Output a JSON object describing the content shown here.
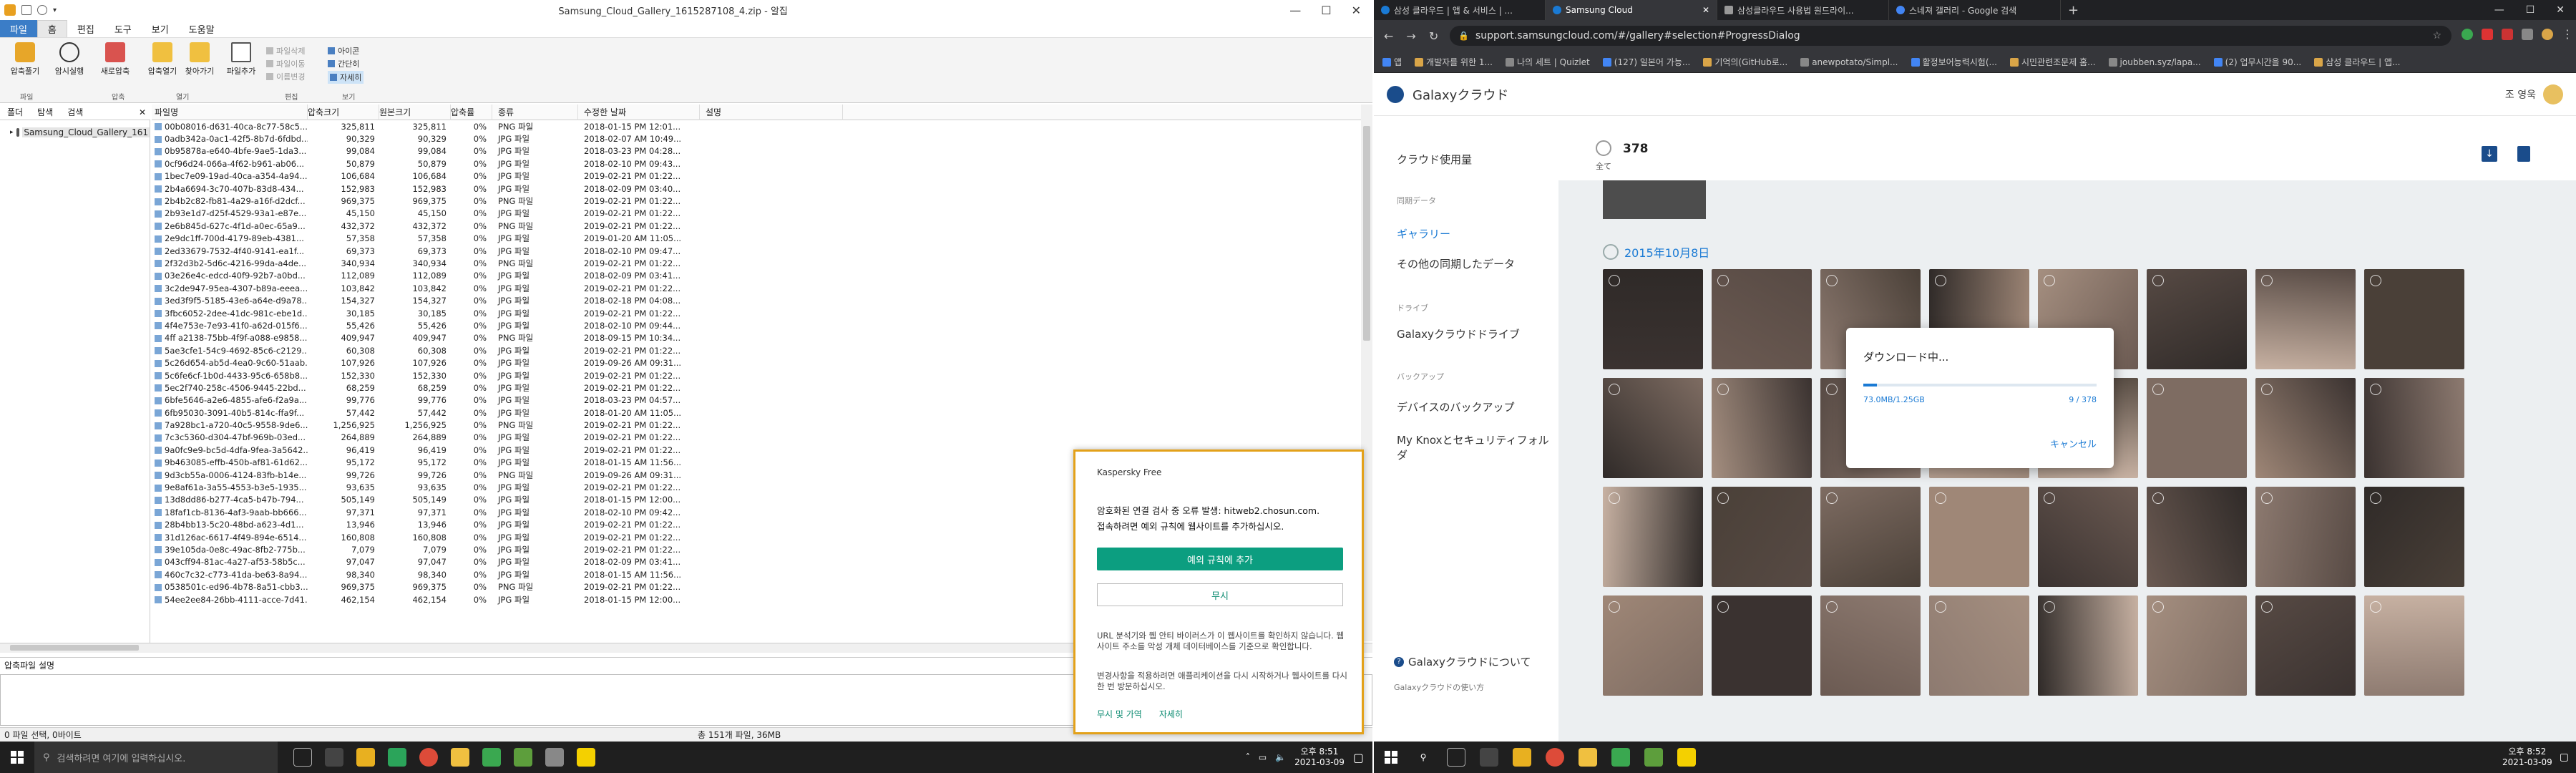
{
  "archive": {
    "title": "Samsung_Cloud_Gallery_1615287108_4.zip - 알집",
    "tabs": [
      "파일",
      "홈",
      "편집",
      "도구",
      "보기",
      "도움말"
    ],
    "ribbon": {
      "buttons": [
        "압축풀기",
        "암시실행",
        "새로압축",
        "압축열기",
        "찾아가기",
        "파일추가"
      ],
      "small": [
        "파일삭제",
        "파일이동",
        "이름변경",
        "아이콘",
        "간단히",
        "자세히"
      ],
      "groups": [
        "파일",
        "압축",
        "열기",
        "편집",
        "보기"
      ]
    },
    "tree_tabs": [
      "폴더",
      "탐색",
      "검색"
    ],
    "tree_root": "Samsung_Cloud_Gallery_161",
    "columns": [
      "파일명",
      "압축크기",
      "원본크기",
      "압축률",
      "종류",
      "수정한 날짜",
      "설명"
    ],
    "rows": [
      [
        "00b08016-d631-40ca-8c77-58c5...",
        "325,811",
        "325,811",
        "0%",
        "PNG 파일",
        "2018-01-15 PM 12:01..."
      ],
      [
        "0adb342a-0ac1-42f5-8b7d-6fdbd...",
        "90,329",
        "90,329",
        "0%",
        "JPG 파일",
        "2018-02-07 AM 10:49..."
      ],
      [
        "0b95878a-e640-4bfe-9ae5-1da3...",
        "99,084",
        "99,084",
        "0%",
        "JPG 파일",
        "2018-03-23 PM 04:28..."
      ],
      [
        "0cf96d24-066a-4f62-b961-ab06...",
        "50,879",
        "50,879",
        "0%",
        "JPG 파일",
        "2018-02-10 PM 09:43..."
      ],
      [
        "1bec7e09-19ad-40ca-a354-4a94...",
        "106,684",
        "106,684",
        "0%",
        "JPG 파일",
        "2019-02-21 PM 01:22..."
      ],
      [
        "2b4a6694-3c70-407b-83d8-434...",
        "152,983",
        "152,983",
        "0%",
        "JPG 파일",
        "2018-02-09 PM 03:40..."
      ],
      [
        "2b4b2c82-fb81-4a29-a16f-d2dcf...",
        "969,375",
        "969,375",
        "0%",
        "PNG 파일",
        "2019-02-21 PM 01:22..."
      ],
      [
        "2b93e1d7-d25f-4529-93a1-e87e...",
        "45,150",
        "45,150",
        "0%",
        "JPG 파일",
        "2019-02-21 PM 01:22..."
      ],
      [
        "2e6b845d-627c-4f1d-a0ec-65a9...",
        "432,372",
        "432,372",
        "0%",
        "PNG 파일",
        "2019-02-21 PM 01:22..."
      ],
      [
        "2e9dc1ff-700d-4179-89eb-4381...",
        "57,358",
        "57,358",
        "0%",
        "JPG 파일",
        "2019-01-20 AM 11:05..."
      ],
      [
        "2ed33679-7532-4f40-9141-ea1f...",
        "69,373",
        "69,373",
        "0%",
        "JPG 파일",
        "2018-02-10 PM 09:47..."
      ],
      [
        "2f32d3b2-5d6c-4216-99da-a4de...",
        "340,934",
        "340,934",
        "0%",
        "PNG 파일",
        "2019-02-21 PM 01:22..."
      ],
      [
        "03e26e4c-edcd-40f9-92b7-a0bd...",
        "112,089",
        "112,089",
        "0%",
        "JPG 파일",
        "2018-02-09 PM 03:41..."
      ],
      [
        "3c2de947-95ea-4307-b89a-eeea...",
        "103,842",
        "103,842",
        "0%",
        "JPG 파일",
        "2019-02-21 PM 01:22..."
      ],
      [
        "3ed3f9f5-5185-43e6-a64e-d9a78...",
        "154,327",
        "154,327",
        "0%",
        "JPG 파일",
        "2018-02-18 PM 04:08..."
      ],
      [
        "3fbc6052-2dee-41dc-981c-ebe1d...",
        "30,185",
        "30,185",
        "0%",
        "JPG 파일",
        "2019-02-21 PM 01:22..."
      ],
      [
        "4f4e753e-7e93-41f0-a62d-015f6...",
        "55,426",
        "55,426",
        "0%",
        "JPG 파일",
        "2018-02-10 PM 09:44..."
      ],
      [
        "4ff a2138-75bb-4f9f-a088-e9858...",
        "409,947",
        "409,947",
        "0%",
        "PNG 파일",
        "2018-09-15 PM 10:34..."
      ],
      [
        "5ae3cfe1-54c9-4692-85c6-c2129...",
        "60,308",
        "60,308",
        "0%",
        "JPG 파일",
        "2019-02-21 PM 01:22..."
      ],
      [
        "5c26d654-ab5d-4ea0-9c60-51aab...",
        "107,926",
        "107,926",
        "0%",
        "JPG 파일",
        "2019-09-26 AM 09:31..."
      ],
      [
        "5c6fe6cf-1b0d-4433-95c6-658b8...",
        "152,330",
        "152,330",
        "0%",
        "JPG 파일",
        "2019-02-21 PM 01:22..."
      ],
      [
        "5ec2f740-258c-4506-9445-22bd...",
        "68,259",
        "68,259",
        "0%",
        "JPG 파일",
        "2019-02-21 PM 01:22..."
      ],
      [
        "6bfe5646-a2e6-4855-afe6-f2a9a...",
        "99,776",
        "99,776",
        "0%",
        "JPG 파일",
        "2018-03-23 PM 04:57..."
      ],
      [
        "6fb95030-3091-40b5-814c-ffa9f...",
        "57,442",
        "57,442",
        "0%",
        "JPG 파일",
        "2018-01-20 AM 11:05..."
      ],
      [
        "7a928bc1-a720-40c5-9558-9de6...",
        "1,256,925",
        "1,256,925",
        "0%",
        "PNG 파일",
        "2019-02-21 PM 01:22..."
      ],
      [
        "7c3c5360-d304-47bf-969b-03ed...",
        "264,889",
        "264,889",
        "0%",
        "JPG 파일",
        "2019-02-21 PM 01:22..."
      ],
      [
        "9a0fc9e9-bc5d-4dfa-9fea-3a5642...",
        "96,419",
        "96,419",
        "0%",
        "JPG 파일",
        "2019-02-21 PM 01:22..."
      ],
      [
        "9b463085-effb-450b-af81-61d62...",
        "95,172",
        "95,172",
        "0%",
        "JPG 파일",
        "2018-01-15 AM 11:56..."
      ],
      [
        "9d3cb55a-0006-4124-83fb-b14e...",
        "99,726",
        "99,726",
        "0%",
        "PNG 파일",
        "2019-09-26 AM 09:31..."
      ],
      [
        "9e8af61a-3a55-4553-b3e5-1935...",
        "93,635",
        "93,635",
        "0%",
        "JPG 파일",
        "2019-02-21 PM 01:22..."
      ],
      [
        "13d8dd86-b277-4ca5-b47b-794...",
        "505,149",
        "505,149",
        "0%",
        "JPG 파일",
        "2018-01-15 PM 12:00..."
      ],
      [
        "18faf1cb-8136-4af3-9aab-bb666...",
        "97,371",
        "97,371",
        "0%",
        "JPG 파일",
        "2018-02-10 PM 09:42..."
      ],
      [
        "28b4bb13-5c20-48bd-a623-4d1...",
        "13,946",
        "13,946",
        "0%",
        "JPG 파일",
        "2019-02-21 PM 01:22..."
      ],
      [
        "31d126ac-6617-4f49-894e-6514...",
        "160,808",
        "160,808",
        "0%",
        "JPG 파일",
        "2019-02-21 PM 01:22..."
      ],
      [
        "39e105da-0e8c-49ac-8fb2-775b...",
        "7,079",
        "7,079",
        "0%",
        "JPG 파일",
        "2019-02-21 PM 01:22..."
      ],
      [
        "043cff94-81ac-4a27-af53-58b5c...",
        "97,047",
        "97,047",
        "0%",
        "JPG 파일",
        "2018-02-09 PM 03:41..."
      ],
      [
        "460c7c32-c773-41da-be63-8a94...",
        "98,340",
        "98,340",
        "0%",
        "JPG 파일",
        "2018-01-15 AM 11:56..."
      ],
      [
        "0538501c-ed96-4b78-8a51-cbb3...",
        "969,375",
        "969,375",
        "0%",
        "PNG 파일",
        "2019-02-21 PM 01:22..."
      ],
      [
        "54ee2ee84-26bb-4111-acce-7d41...",
        "462,154",
        "462,154",
        "0%",
        "JPG 파일",
        "2018-01-15 PM 12:00..."
      ]
    ],
    "comment_label": "압축파일 설명",
    "status_left": "0 파일 선택, 0바이트",
    "status_mid": "총 151개 파일, 36MB"
  },
  "kaspersky": {
    "title": "Kaspersky Free",
    "line1": "암호화된 연결 검사 중 오류 발생: hitweb2.chosun.com.",
    "line2": "접속하려면 예외 규칙에 웹사이트를 추가하십시오.",
    "add_button": "예외 규칙에 추가",
    "ignore_button": "무시",
    "note1": "URL 분석기와 웹 안티 바이러스가 이 웹사이트를 확인하지 않습니다. 웹사이트 주소를 악성 개체 데이터베이스를 기준으로 확인합니다.",
    "note2": "변경사항을 적용하려면 애플리케이션을 다시 시작하거나 웹사이트를 다시 한 번 방문하십시오.",
    "link_ignore_close": "무시 및 가역",
    "link_details": "자세히"
  },
  "taskbar_left": {
    "search_placeholder": "검색하려면 여기에 입력하십시오.",
    "time": "오후 8:51",
    "date": "2021-03-09"
  },
  "taskbar_right": {
    "time": "오후 8:52",
    "date": "2021-03-09"
  },
  "chrome": {
    "tabs": [
      "삼성 클라우드 | 앱 & 서비스 | ...",
      "Samsung Cloud",
      "삼성클라우드 사용법 원드라이...",
      "스네져 갤러리 - Google 검색"
    ],
    "url": "support.samsungcloud.com/#/gallery#selection#ProgressDialog",
    "bookmarks": [
      "앱",
      "개발자를 위한 1...",
      "나의 세트 | Quizlet",
      "(127) 일본어 가능...",
      "기억의(GitHub로...",
      "anewpotato/Simpl...",
      "활정보어능력시험(...",
      "시민관련조문제 홈...",
      "joubben.syz/lapa...",
      "(2) 업무시간을 90...",
      "삼성 클라우드 | 앱..."
    ]
  },
  "gallery": {
    "brand": "Galaxyクラウド",
    "user": "조 영욱",
    "side": {
      "usage": "クラウド使用量",
      "sync_head": "同期データ",
      "gallery": "ギャラリー",
      "other_sync": "その他の同期したデータ",
      "drive_head": "ドライブ",
      "drive": "Galaxyクラウドドライブ",
      "backup_head": "バックアップ",
      "device_backup": "デバイスのバックアップ",
      "knox": "My Knoxとセキュリティフォルダ",
      "about": "Galaxyクラウドについて",
      "howto": "Galaxyクラウドの使い方"
    },
    "select_all": "全て",
    "count": "378",
    "date_header": "2015年10月8日",
    "accent": "#1a7ad4"
  },
  "download_dialog": {
    "title": "ダウンロード中...",
    "progress_text": "73.0MB/1.25GB",
    "count_text": "9 / 378",
    "progress": 0.058,
    "cancel": "キャンセル"
  }
}
